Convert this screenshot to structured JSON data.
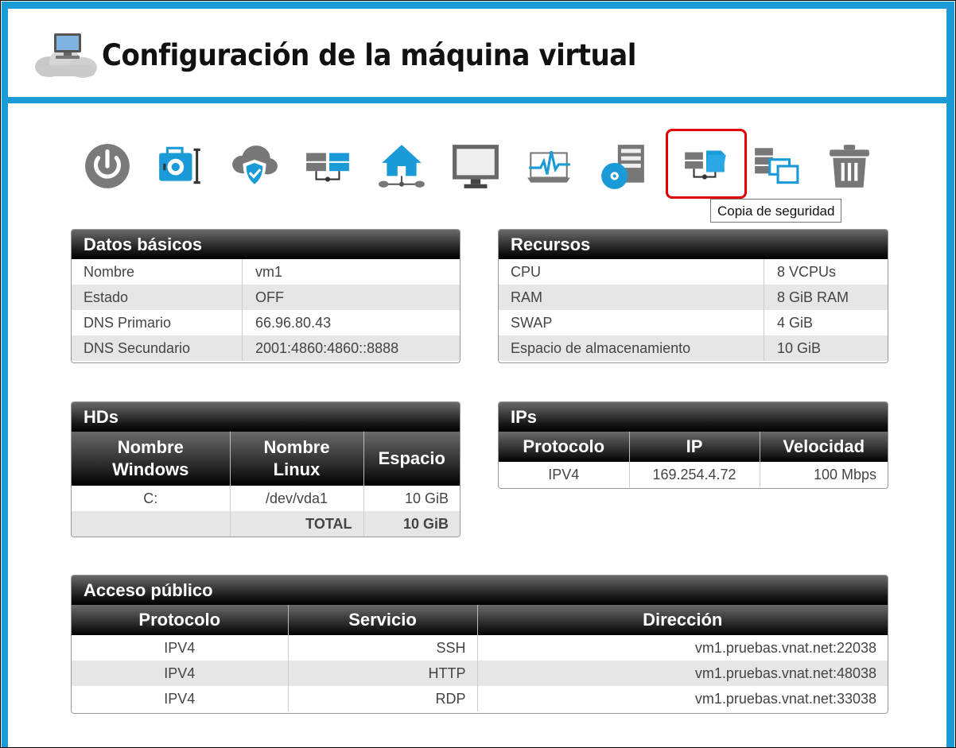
{
  "header": {
    "title": "Configuración de la máquina virtual"
  },
  "toolbar": {
    "tooltip": "Copia de seguridad",
    "colors": {
      "accent": "#1a9ad6",
      "icon_gray": "#777777",
      "active_border": "#e00000"
    }
  },
  "basic": {
    "title": "Datos básicos",
    "rows": [
      {
        "k": "Nombre",
        "v": "vm1"
      },
      {
        "k": "Estado",
        "v": "OFF"
      },
      {
        "k": "DNS Primario",
        "v": "66.96.80.43"
      },
      {
        "k": "DNS Secundario",
        "v": "2001:4860:4860::8888"
      }
    ]
  },
  "resources": {
    "title": "Recursos",
    "rows": [
      {
        "k": "CPU",
        "v": "8 VCPUs"
      },
      {
        "k": "RAM",
        "v": "8 GiB RAM"
      },
      {
        "k": "SWAP",
        "v": "4 GiB"
      },
      {
        "k": "Espacio de almacenamiento",
        "v": "10 GiB"
      }
    ]
  },
  "hds": {
    "title": "HDs",
    "headers": {
      "win1": "Nombre",
      "win2": "Windows",
      "lin1": "Nombre",
      "lin2": "Linux",
      "space": "Espacio"
    },
    "rows": [
      {
        "win": "C:",
        "lin": "/dev/vda1",
        "space": "10 GiB"
      }
    ],
    "total_label": "TOTAL",
    "total_value": "10 GiB"
  },
  "ips": {
    "title": "IPs",
    "headers": [
      "Protocolo",
      "IP",
      "Velocidad"
    ],
    "rows": [
      {
        "proto": "IPV4",
        "ip": "169.254.4.72",
        "speed": "100 Mbps"
      }
    ]
  },
  "public": {
    "title": "Acceso público",
    "headers": [
      "Protocolo",
      "Servicio",
      "Dirección"
    ],
    "rows": [
      {
        "proto": "IPV4",
        "service": "SSH",
        "addr": "vm1.pruebas.vnat.net:22038"
      },
      {
        "proto": "IPV4",
        "service": "HTTP",
        "addr": "vm1.pruebas.vnat.net:48038"
      },
      {
        "proto": "IPV4",
        "service": "RDP",
        "addr": "vm1.pruebas.vnat.net:33038"
      }
    ]
  }
}
